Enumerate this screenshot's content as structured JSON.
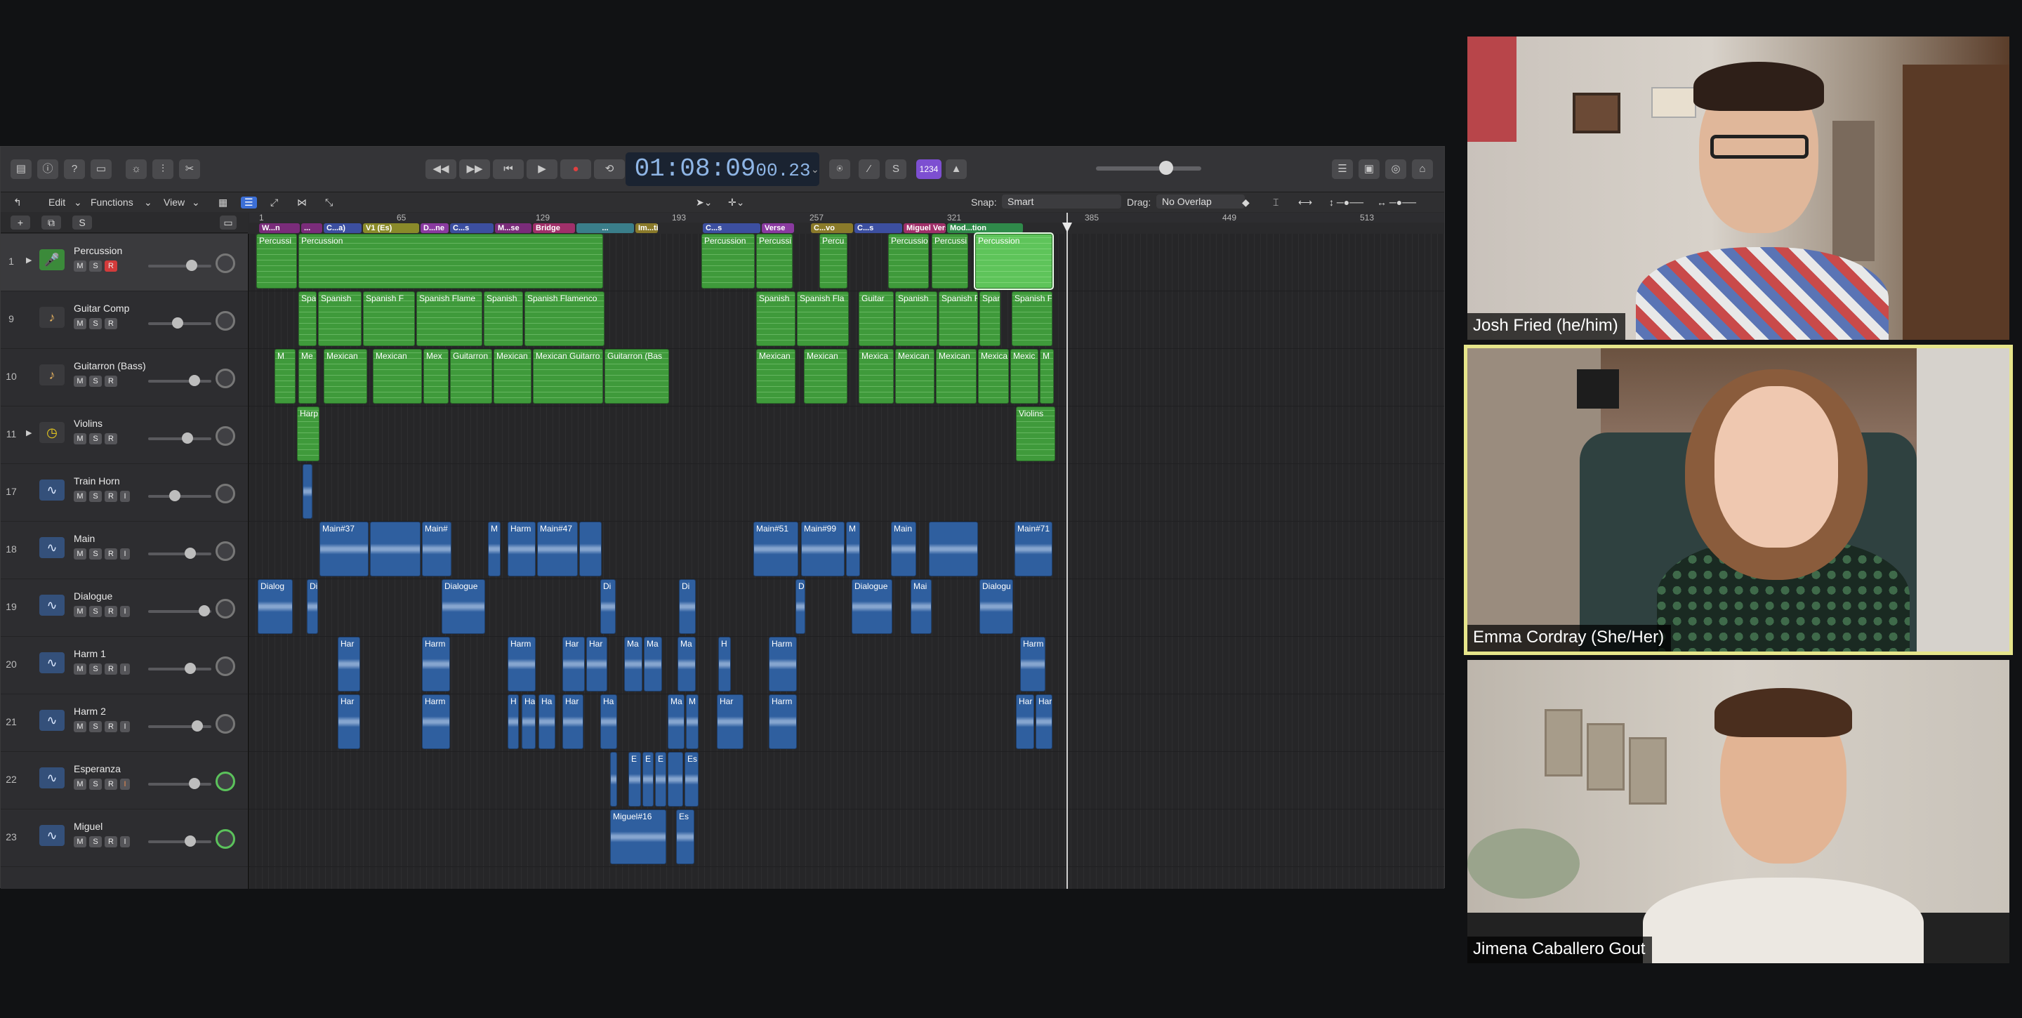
{
  "transport": {
    "time": "01:08:09",
    "time_frames": "00.23",
    "count_in_label": "1234"
  },
  "menubar": {
    "edit": "Edit",
    "functions": "Functions",
    "view": "View",
    "snap_label": "Snap:",
    "snap_value": "Smart",
    "drag_label": "Drag:",
    "drag_value": "No Overlap"
  },
  "track_header_buttons": {
    "add": "+",
    "solo": "S"
  },
  "ruler": [
    "1",
    "65",
    "129",
    "193",
    "257",
    "321",
    "385",
    "449",
    "513"
  ],
  "markers": [
    "W...n",
    "...",
    "C...a)",
    "V1 (Es)",
    "D...ne",
    "C...s",
    "M...se",
    "Bridge",
    "...",
    "Im...tion",
    "C...s",
    "Verse",
    "C...vo",
    "C...s",
    "Miguel Verse",
    "Mod...tion"
  ],
  "tracks": [
    {
      "num": "1",
      "name": "Percussion"
    },
    {
      "num": "9",
      "name": "Guitar Comp"
    },
    {
      "num": "10",
      "name": "Guitarron (Bass)"
    },
    {
      "num": "11",
      "name": "Violins"
    },
    {
      "num": "17",
      "name": "Train Horn"
    },
    {
      "num": "18",
      "name": "Main"
    },
    {
      "num": "19",
      "name": "Dialogue"
    },
    {
      "num": "20",
      "name": "Harm 1"
    },
    {
      "num": "21",
      "name": "Harm 2"
    },
    {
      "num": "22",
      "name": "Esperanza"
    },
    {
      "num": "23",
      "name": "Miguel"
    }
  ],
  "button_labels": {
    "mute": "M",
    "solo": "S",
    "record": "R",
    "input": "I"
  },
  "regions": {
    "percussion": [
      "Percussi",
      "Percussion",
      "Percussion",
      "Percussi",
      "Percu",
      "Percussio",
      "Percussi",
      "Percussion"
    ],
    "guitar_comp": [
      "Spa",
      "Spanish",
      "Spanish F",
      "Spanish Flame",
      "Spanish",
      "Spanish Flamenco",
      "Spanish",
      "Spanish Fla",
      "Guitar",
      "Spanish",
      "Spanish F",
      "Spanish",
      "Spanish F"
    ],
    "guitarron": [
      "M",
      "Me",
      "Mexican",
      "Mexican",
      "Mex",
      "Guitarron",
      "Mexican",
      "Mexican Guitarro",
      "Guitarron (Bas",
      "Mexican",
      "Mexican",
      "Mexica",
      "Mexican",
      "Mexican",
      "Mexica",
      "Mexic",
      "M"
    ],
    "violins": [
      "Harp",
      "Violins"
    ],
    "main": [
      "Main#37",
      "Main#",
      "M",
      "Harm",
      "Main#47",
      "Main#51",
      "Main#99",
      "M",
      "Main",
      "Main#71"
    ],
    "dialogue": [
      "Dialog",
      "Di",
      "Dialogue",
      "Di",
      "Di",
      "D",
      "Dialogue",
      "Mai",
      "Dialogu"
    ],
    "harm1": [
      "Har",
      "Harm",
      "Harm",
      "Har",
      "Har",
      "Ma",
      "Ma",
      "Ma",
      "H",
      "Harm",
      "Harm"
    ],
    "harm2": [
      "Har",
      "Harm",
      "H",
      "Ha",
      "Ha",
      "Har",
      "Ha",
      "Ma",
      "M",
      "Har",
      "Harm",
      "Har",
      "Har"
    ],
    "esperanza": [
      "E",
      "E",
      "E",
      "Es"
    ],
    "miguel": [
      "Miguel#16",
      "Es"
    ]
  },
  "participants": [
    {
      "name": "Josh Fried (he/him)"
    },
    {
      "name": "Emma Cordray (She/Her)"
    },
    {
      "name": "Jimena Caballero Gout"
    }
  ],
  "colors": {
    "midi_region": "#3f9a3b",
    "audio_region": "#2f5f9f",
    "active_speaker_border": "#e6e58b",
    "record_button": "#d23b3b",
    "lcd_text": "#8fb6e6"
  }
}
